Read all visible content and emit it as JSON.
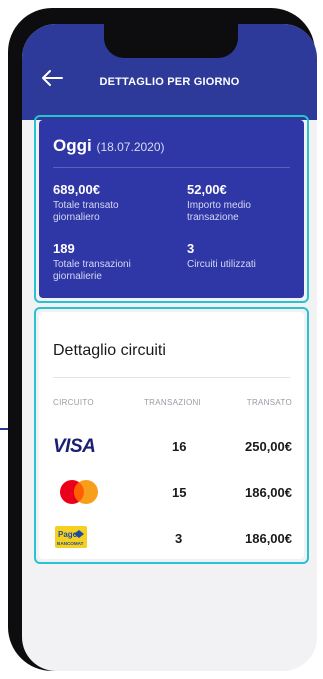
{
  "header": {
    "title": "DETTAGLIO PER GIORNO"
  },
  "summary": {
    "title": "Oggi",
    "date": "(18.07.2020)",
    "stats": [
      {
        "value": "689,00€",
        "label": "Totale transato giornaliero"
      },
      {
        "value": "52,00€",
        "label": "Importo medio transazione"
      },
      {
        "value": "189",
        "label": "Totale transazioni giornalierie"
      },
      {
        "value": "3",
        "label": "Circuiti utilizzati"
      }
    ]
  },
  "circuits": {
    "title": "Dettaglio circuiti",
    "columns": [
      "CIRCUITO",
      "TRANSAZIONI",
      "TRANSATO"
    ],
    "rows": [
      {
        "circuit": "VISA",
        "transactions": "16",
        "amount": "250,00€"
      },
      {
        "circuit": "Mastercard",
        "transactions": "15",
        "amount": "186,00€"
      },
      {
        "circuit": "PagoBANCOMAT",
        "transactions": "3",
        "amount": "186,00€"
      }
    ],
    "logos": {
      "visa": "VISA",
      "pago_top": "Pago",
      "pago_bottom": "BANCOMAT"
    }
  },
  "colors": {
    "appbar": "#2e3a9a",
    "summary_card": "#2f36a6",
    "highlight": "#27c3cf",
    "mc_red": "#eb001b",
    "mc_yellow": "#f79e1b"
  }
}
